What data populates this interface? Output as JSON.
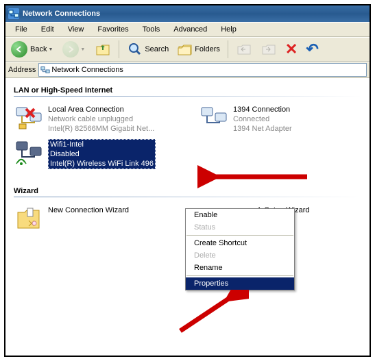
{
  "window": {
    "title": "Network Connections"
  },
  "menubar": [
    "File",
    "Edit",
    "View",
    "Favorites",
    "Tools",
    "Advanced",
    "Help"
  ],
  "toolbar": {
    "back": "Back",
    "search": "Search",
    "folders": "Folders"
  },
  "addressbar": {
    "label": "Address",
    "value": "Network Connections"
  },
  "groups": {
    "lan_title": "LAN or High-Speed Internet",
    "wizard_title": "Wizard"
  },
  "connections": {
    "lac": {
      "name": "Local Area Connection",
      "status": "Network cable unplugged",
      "device": "Intel(R) 82566MM Gigabit Net..."
    },
    "c1394": {
      "name": "1394 Connection",
      "status": "Connected",
      "device": "1394 Net Adapter"
    },
    "wifi": {
      "name": "Wifi1-Intel",
      "status": "Disabled",
      "device": "Intel(R) Wireless WiFi Link 496"
    },
    "ncw": {
      "name": "New Connection Wizard"
    },
    "nsw": {
      "name": "Network Setup Wizard"
    }
  },
  "contextmenu": {
    "enable": "Enable",
    "status": "Status",
    "create_shortcut": "Create Shortcut",
    "delete": "Delete",
    "rename": "Rename",
    "properties": "Properties"
  }
}
